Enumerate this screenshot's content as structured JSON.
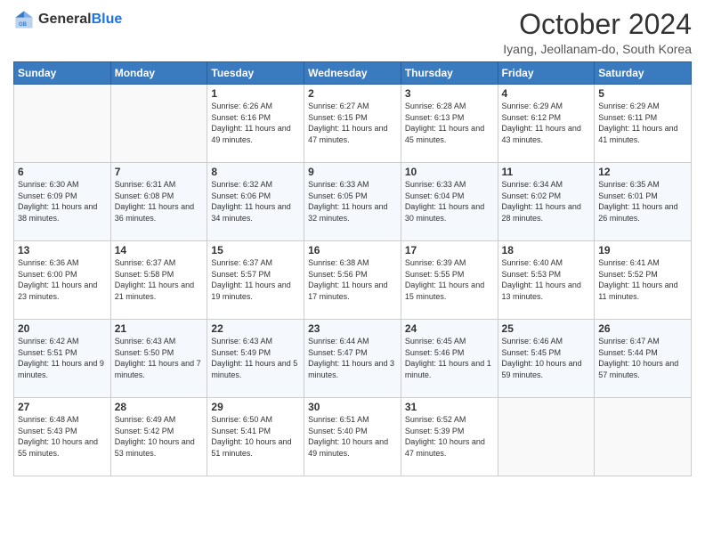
{
  "logo": {
    "general": "General",
    "blue": "Blue"
  },
  "title": "October 2024",
  "subtitle": "Iyang, Jeollanam-do, South Korea",
  "days_of_week": [
    "Sunday",
    "Monday",
    "Tuesday",
    "Wednesday",
    "Thursday",
    "Friday",
    "Saturday"
  ],
  "weeks": [
    [
      {
        "day": "",
        "info": ""
      },
      {
        "day": "",
        "info": ""
      },
      {
        "day": "1",
        "info": "Sunrise: 6:26 AM\nSunset: 6:16 PM\nDaylight: 11 hours and 49 minutes."
      },
      {
        "day": "2",
        "info": "Sunrise: 6:27 AM\nSunset: 6:15 PM\nDaylight: 11 hours and 47 minutes."
      },
      {
        "day": "3",
        "info": "Sunrise: 6:28 AM\nSunset: 6:13 PM\nDaylight: 11 hours and 45 minutes."
      },
      {
        "day": "4",
        "info": "Sunrise: 6:29 AM\nSunset: 6:12 PM\nDaylight: 11 hours and 43 minutes."
      },
      {
        "day": "5",
        "info": "Sunrise: 6:29 AM\nSunset: 6:11 PM\nDaylight: 11 hours and 41 minutes."
      }
    ],
    [
      {
        "day": "6",
        "info": "Sunrise: 6:30 AM\nSunset: 6:09 PM\nDaylight: 11 hours and 38 minutes."
      },
      {
        "day": "7",
        "info": "Sunrise: 6:31 AM\nSunset: 6:08 PM\nDaylight: 11 hours and 36 minutes."
      },
      {
        "day": "8",
        "info": "Sunrise: 6:32 AM\nSunset: 6:06 PM\nDaylight: 11 hours and 34 minutes."
      },
      {
        "day": "9",
        "info": "Sunrise: 6:33 AM\nSunset: 6:05 PM\nDaylight: 11 hours and 32 minutes."
      },
      {
        "day": "10",
        "info": "Sunrise: 6:33 AM\nSunset: 6:04 PM\nDaylight: 11 hours and 30 minutes."
      },
      {
        "day": "11",
        "info": "Sunrise: 6:34 AM\nSunset: 6:02 PM\nDaylight: 11 hours and 28 minutes."
      },
      {
        "day": "12",
        "info": "Sunrise: 6:35 AM\nSunset: 6:01 PM\nDaylight: 11 hours and 26 minutes."
      }
    ],
    [
      {
        "day": "13",
        "info": "Sunrise: 6:36 AM\nSunset: 6:00 PM\nDaylight: 11 hours and 23 minutes."
      },
      {
        "day": "14",
        "info": "Sunrise: 6:37 AM\nSunset: 5:58 PM\nDaylight: 11 hours and 21 minutes."
      },
      {
        "day": "15",
        "info": "Sunrise: 6:37 AM\nSunset: 5:57 PM\nDaylight: 11 hours and 19 minutes."
      },
      {
        "day": "16",
        "info": "Sunrise: 6:38 AM\nSunset: 5:56 PM\nDaylight: 11 hours and 17 minutes."
      },
      {
        "day": "17",
        "info": "Sunrise: 6:39 AM\nSunset: 5:55 PM\nDaylight: 11 hours and 15 minutes."
      },
      {
        "day": "18",
        "info": "Sunrise: 6:40 AM\nSunset: 5:53 PM\nDaylight: 11 hours and 13 minutes."
      },
      {
        "day": "19",
        "info": "Sunrise: 6:41 AM\nSunset: 5:52 PM\nDaylight: 11 hours and 11 minutes."
      }
    ],
    [
      {
        "day": "20",
        "info": "Sunrise: 6:42 AM\nSunset: 5:51 PM\nDaylight: 11 hours and 9 minutes."
      },
      {
        "day": "21",
        "info": "Sunrise: 6:43 AM\nSunset: 5:50 PM\nDaylight: 11 hours and 7 minutes."
      },
      {
        "day": "22",
        "info": "Sunrise: 6:43 AM\nSunset: 5:49 PM\nDaylight: 11 hours and 5 minutes."
      },
      {
        "day": "23",
        "info": "Sunrise: 6:44 AM\nSunset: 5:47 PM\nDaylight: 11 hours and 3 minutes."
      },
      {
        "day": "24",
        "info": "Sunrise: 6:45 AM\nSunset: 5:46 PM\nDaylight: 11 hours and 1 minute."
      },
      {
        "day": "25",
        "info": "Sunrise: 6:46 AM\nSunset: 5:45 PM\nDaylight: 10 hours and 59 minutes."
      },
      {
        "day": "26",
        "info": "Sunrise: 6:47 AM\nSunset: 5:44 PM\nDaylight: 10 hours and 57 minutes."
      }
    ],
    [
      {
        "day": "27",
        "info": "Sunrise: 6:48 AM\nSunset: 5:43 PM\nDaylight: 10 hours and 55 minutes."
      },
      {
        "day": "28",
        "info": "Sunrise: 6:49 AM\nSunset: 5:42 PM\nDaylight: 10 hours and 53 minutes."
      },
      {
        "day": "29",
        "info": "Sunrise: 6:50 AM\nSunset: 5:41 PM\nDaylight: 10 hours and 51 minutes."
      },
      {
        "day": "30",
        "info": "Sunrise: 6:51 AM\nSunset: 5:40 PM\nDaylight: 10 hours and 49 minutes."
      },
      {
        "day": "31",
        "info": "Sunrise: 6:52 AM\nSunset: 5:39 PM\nDaylight: 10 hours and 47 minutes."
      },
      {
        "day": "",
        "info": ""
      },
      {
        "day": "",
        "info": ""
      }
    ]
  ]
}
